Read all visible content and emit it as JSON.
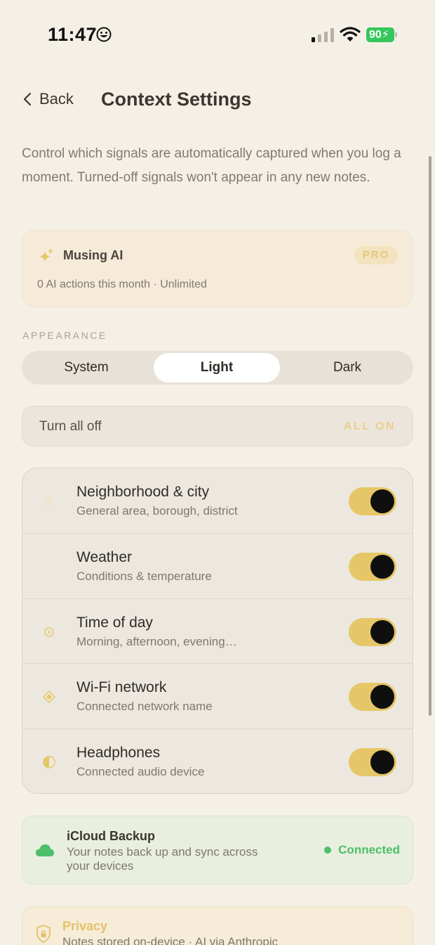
{
  "status_bar": {
    "time": "11:47",
    "battery": "90"
  },
  "nav": {
    "back_label": "Back",
    "title": "Context Settings"
  },
  "intro": "Control which signals are automatically captured when you log a moment. Turned-off signals won't appear in any new notes.",
  "ai_card": {
    "title": "Musing AI",
    "badge": "PRO",
    "subtitle": "0 AI actions this month · Unlimited"
  },
  "appearance": {
    "section_label": "APPEARANCE",
    "options": [
      "System",
      "Light",
      "Dark"
    ],
    "selected": "Light"
  },
  "turn_all": {
    "label": "Turn all off",
    "state": "ALL ON"
  },
  "signals": [
    {
      "title": "Neighborhood & city",
      "subtitle": "General area, borough, district",
      "icon": "crosshair-icon",
      "enabled": true
    },
    {
      "title": "Weather",
      "subtitle": "Conditions & temperature",
      "icon": "weather-icon",
      "enabled": true
    },
    {
      "title": "Time of day",
      "subtitle": "Morning, afternoon, evening…",
      "icon": "clock-icon",
      "enabled": true
    },
    {
      "title": "Wi-Fi network",
      "subtitle": "Connected network name",
      "icon": "diamond-icon",
      "enabled": true
    },
    {
      "title": "Headphones",
      "subtitle": "Connected audio device",
      "icon": "half-circle-icon",
      "enabled": true
    }
  ],
  "icloud": {
    "title": "iCloud Backup",
    "subtitle": "Your notes back up and sync across your devices",
    "status": "Connected"
  },
  "privacy": {
    "title": "Privacy",
    "subtitle": "Notes stored on-device · AI via Anthropic"
  },
  "colors": {
    "background": "#f5f0e6",
    "accent_gold": "#e6c767",
    "connected_green": "#4cbf6b",
    "battery_green": "#34c759"
  }
}
